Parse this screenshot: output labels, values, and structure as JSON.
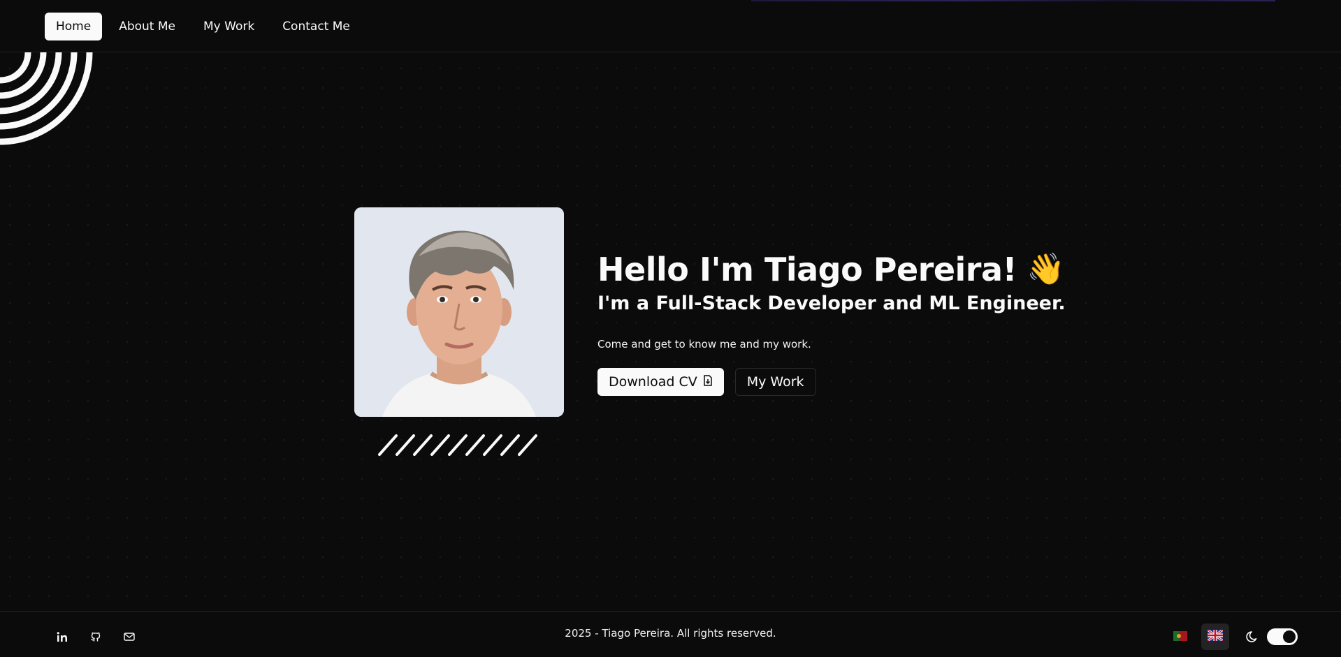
{
  "nav": {
    "items": [
      {
        "label": "Home",
        "active": true
      },
      {
        "label": "About Me",
        "active": false
      },
      {
        "label": "My Work",
        "active": false
      },
      {
        "label": "Contact Me",
        "active": false
      }
    ]
  },
  "hero": {
    "photo_alt": "Portrait of Tiago Pereira",
    "title": "Hello I'm Tiago Pereira!",
    "wave_emoji": "👋",
    "subtitle": "I'm a Full-Stack Developer and ML Engineer.",
    "description": "Come and get to know me and my work.",
    "buttons": {
      "download_cv": "Download CV",
      "my_work": "My Work"
    }
  },
  "footer": {
    "copyright": "2025 - Tiago Pereira. All rights reserved.",
    "social_icons": [
      "linkedin-icon",
      "github-icon",
      "mail-icon"
    ],
    "languages": [
      {
        "code": "pt",
        "icon": "portugal-flag-icon",
        "active": false
      },
      {
        "code": "en",
        "icon": "uk-flag-icon",
        "active": true
      }
    ],
    "theme": {
      "icon": "moon-icon",
      "dark_mode": true
    }
  },
  "colors": {
    "background": "#0b0b0c",
    "foreground": "#fafafa",
    "border": "#222225",
    "photo_background": "#e2e7ef"
  }
}
